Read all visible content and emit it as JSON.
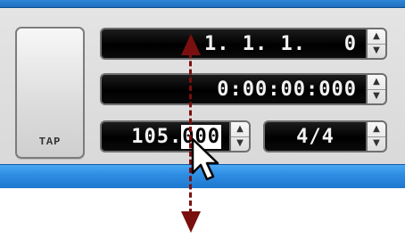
{
  "transport": {
    "tap_label": "TAP",
    "position_bars": "1. 1. 1.   0",
    "position_time": "0:00:00:000",
    "tempo_integer": "105.",
    "tempo_fraction": "000",
    "time_signature": "4/4"
  },
  "icons": {
    "stepper_up": "▲",
    "stepper_down": "▼",
    "cursor": "arrow-pointer-icon",
    "guide_up": "arrow-up-icon",
    "guide_down": "arrow-down-icon"
  },
  "colors": {
    "guide": "#7a0f0f",
    "display_bg": "#000000",
    "display_text": "#f2f2f2",
    "accent_bar": "#2e8ee3"
  }
}
